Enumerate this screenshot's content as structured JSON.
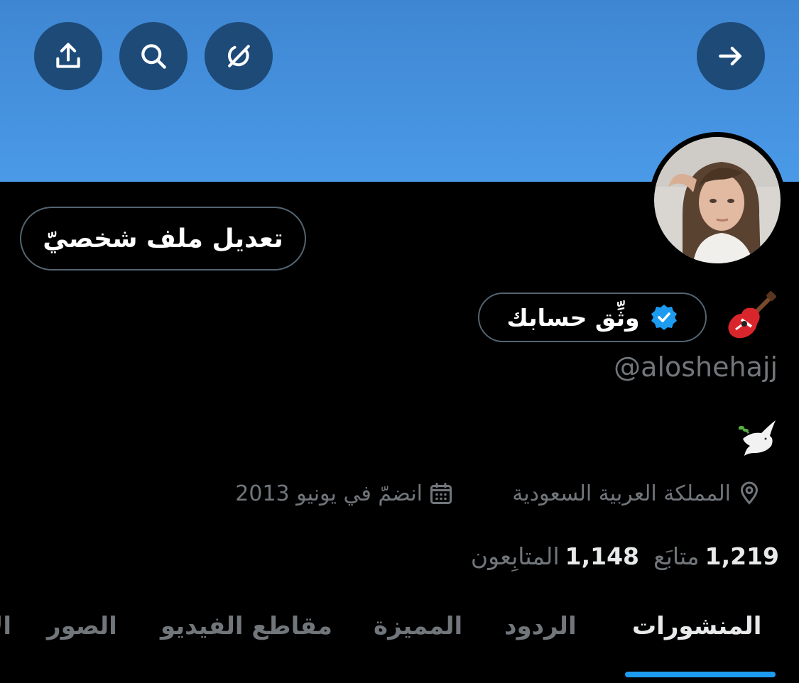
{
  "header": {
    "share_icon": "share-upload-icon",
    "search_icon": "search-icon",
    "grok_icon": "grok-icon",
    "back_icon": "arrow-right-icon",
    "banner_color": "#4a9ae8",
    "button_color": "#1e4a78"
  },
  "profile": {
    "edit_button_label": "تعديل ملف شخصيّ",
    "verify_label": "وثِّق حسابك",
    "name_emoji": "🎸",
    "handle": "@aloshehajj",
    "bio_emoji": "🕊️",
    "location": "المملكة العربية السعودية",
    "location_icon": "location-pin-icon",
    "joined": "انضمّ في يونيو 2013",
    "joined_icon": "calendar-icon",
    "following_count": "1,219",
    "following_label": "متابَع",
    "followers_count": "1,148",
    "followers_label": "المتابِعون",
    "verified_color": "#1d9bf0"
  },
  "tabs": [
    {
      "label": "المنشورات",
      "active": true
    },
    {
      "label": "الردود",
      "active": false
    },
    {
      "label": "المميزة",
      "active": false
    },
    {
      "label": "مقاطع الفيديو",
      "active": false
    },
    {
      "label": "الصور",
      "active": false
    },
    {
      "label": "الإعجابات",
      "active": false
    }
  ]
}
